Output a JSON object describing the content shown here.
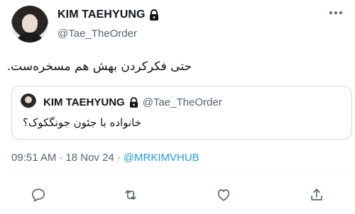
{
  "tweet": {
    "author_name": "KIM TAEHYUNG",
    "author_handle": "@Tae_TheOrder",
    "text": "حتی فکرکردن بهش هم مسخره‌ست.",
    "timestamp": "09:51 AM",
    "separator": "·",
    "date": "18 Nov 24",
    "via": "@MRKIMVHUB"
  },
  "quoted": {
    "author_name": "KIM TAEHYUNG",
    "author_handle": "@Tae_TheOrder",
    "text": "خانواده با جئون جونگکوک؟"
  },
  "icons": {
    "lock": "lock-icon",
    "more": "more-icon",
    "reply": "reply-icon",
    "retweet": "retweet-icon",
    "like": "heart-icon",
    "share": "share-icon"
  },
  "colors": {
    "accent": "#1d9bf0",
    "secondary_text": "#536471",
    "border": "#cfd9de"
  }
}
